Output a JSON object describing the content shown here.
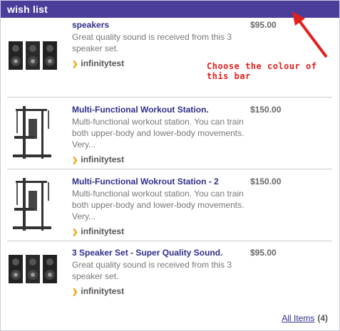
{
  "widget": {
    "title": "wish list",
    "bar_color": "#4b3d9a"
  },
  "annotation": {
    "text": "Choose the colour of this bar",
    "color": "#e0201d"
  },
  "items": [
    {
      "title": "speakers",
      "description": "Great quality sound is received from this 3 speaker set.",
      "price": "$95.00",
      "seller": "infinitytest",
      "image": "speaker-set-image"
    },
    {
      "title": "Multi-Functional Workout Station.",
      "description": "Multi-functional workout station. You can train both upper-body and lower-body movements. Very...",
      "price": "$150.00",
      "seller": "infinitytest",
      "image": "workout-station-image"
    },
    {
      "title": "Multi-Functional Wokrout Station - 2",
      "description": "Multi-functional workout station. You can train both upper-body and lower-body movements. Very...",
      "price": "$150.00",
      "seller": "infinitytest",
      "image": "workout-station-image"
    },
    {
      "title": "3 Speaker Set - Super Quality Sound.",
      "description": "Great quality sound is received from this 3 speaker set.",
      "price": "$95.00",
      "seller": "infinitytest",
      "image": "speaker-set-image"
    }
  ],
  "footer": {
    "link_label": "All Items",
    "count": "(4)"
  }
}
